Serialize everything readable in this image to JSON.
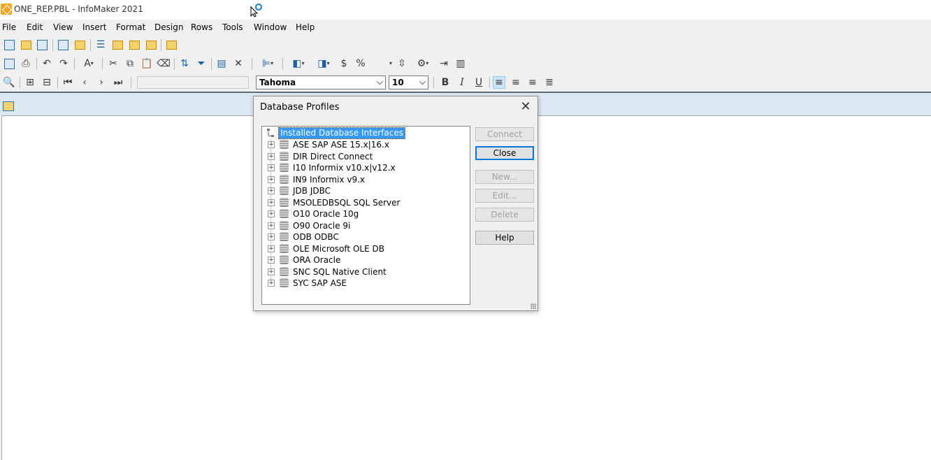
{
  "window": {
    "title": "ONE_REP.PBL - InfoMaker 2021"
  },
  "menubar": {
    "items": [
      "File",
      "Edit",
      "View",
      "Insert",
      "Format",
      "Design",
      "Rows",
      "Tools",
      "Window",
      "Help"
    ]
  },
  "toolbar": {
    "font_name": "Tahoma",
    "font_size": "10",
    "currency_label": "$",
    "percent_label": "%",
    "bold_label": "B",
    "italic_label": "I",
    "underline_label": "U",
    "text_color_label": "A"
  },
  "dialog": {
    "title": "Database Profiles",
    "tree_root": "Installed Database Interfaces",
    "interfaces": [
      "ASE SAP ASE 15.x|16.x",
      "DIR Direct Connect",
      "I10 Informix v10.x|v12.x",
      "IN9 Informix v9.x",
      "JDB JDBC",
      "MSOLEDBSQL SQL Server",
      "O10 Oracle 10g",
      "O90 Oracle 9i",
      "ODB ODBC",
      "OLE Microsoft OLE DB",
      "ORA Oracle",
      "SNC SQL Native Client",
      "SYC SAP ASE"
    ],
    "buttons": {
      "connect": "Connect",
      "close": "Close",
      "new": "New...",
      "edit": "Edit...",
      "delete": "Delete",
      "help": "Help"
    }
  }
}
